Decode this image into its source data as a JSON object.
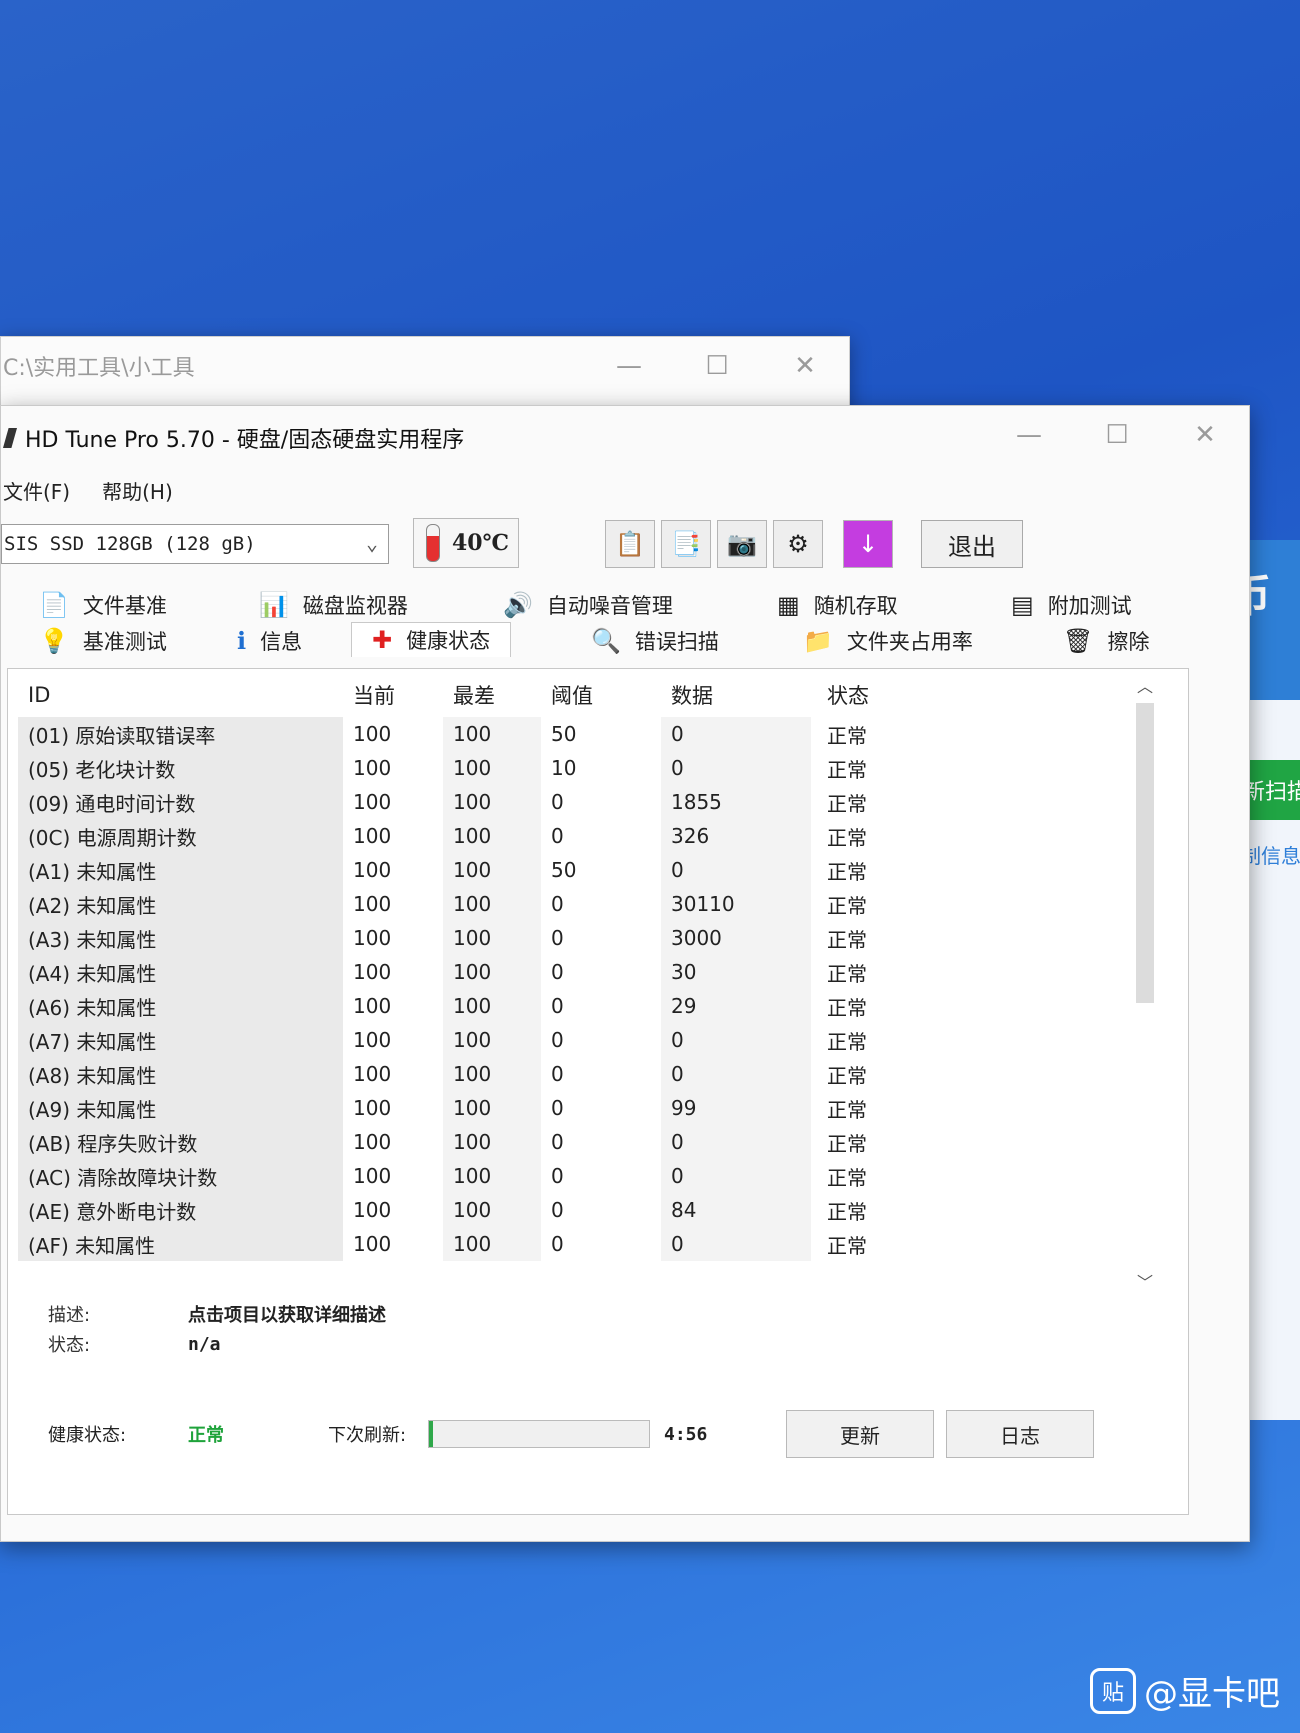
{
  "bg_window": {
    "title": "C:\\实用工具\\小工具",
    "min": "—",
    "max": "☐",
    "close": "✕"
  },
  "right_app": {
    "logo": "币",
    "rescan": "重新扫描",
    "copy": "复制信息"
  },
  "window": {
    "title": "HD Tune Pro 5.70 - 硬盘/固态硬盘实用程序",
    "min": "—",
    "max": "☐",
    "close": "✕"
  },
  "menu": [
    "文件(F)",
    "帮助(H)"
  ],
  "toolbar": {
    "drive": "SIS SSD 128GB (128 gB)",
    "temperature": "40℃",
    "exit": "退出"
  },
  "tabs_top": [
    {
      "label": "文件基准",
      "icon": "📄"
    },
    {
      "label": "磁盘监视器",
      "icon": "📊"
    },
    {
      "label": "自动噪音管理",
      "icon": "🔊"
    },
    {
      "label": "随机存取",
      "icon": "▦"
    },
    {
      "label": "附加测试",
      "icon": "▤"
    }
  ],
  "tabs_bottom": [
    {
      "label": "基准测试",
      "icon": "💡"
    },
    {
      "label": "信息",
      "icon": "ℹ"
    },
    {
      "label": "健康状态",
      "icon": "✚"
    },
    {
      "label": "错误扫描",
      "icon": "🔍"
    },
    {
      "label": "文件夹占用率",
      "icon": "📁"
    },
    {
      "label": "擦除",
      "icon": "🗑"
    }
  ],
  "table": {
    "headers": {
      "id": "ID",
      "current": "当前",
      "worst": "最差",
      "threshold": "阈值",
      "data": "数据",
      "status": "状态"
    },
    "rows": [
      [
        "(01) 原始读取错误率",
        "100",
        "100",
        "50",
        "0",
        "正常"
      ],
      [
        "(05) 老化块计数",
        "100",
        "100",
        "10",
        "0",
        "正常"
      ],
      [
        "(09) 通电时间计数",
        "100",
        "100",
        "0",
        "1855",
        "正常"
      ],
      [
        "(0C) 电源周期计数",
        "100",
        "100",
        "0",
        "326",
        "正常"
      ],
      [
        "(A1) 未知属性",
        "100",
        "100",
        "50",
        "0",
        "正常"
      ],
      [
        "(A2) 未知属性",
        "100",
        "100",
        "0",
        "30110",
        "正常"
      ],
      [
        "(A3) 未知属性",
        "100",
        "100",
        "0",
        "3000",
        "正常"
      ],
      [
        "(A4) 未知属性",
        "100",
        "100",
        "0",
        "30",
        "正常"
      ],
      [
        "(A6) 未知属性",
        "100",
        "100",
        "0",
        "29",
        "正常"
      ],
      [
        "(A7) 未知属性",
        "100",
        "100",
        "0",
        "0",
        "正常"
      ],
      [
        "(A8) 未知属性",
        "100",
        "100",
        "0",
        "0",
        "正常"
      ],
      [
        "(A9) 未知属性",
        "100",
        "100",
        "0",
        "99",
        "正常"
      ],
      [
        "(AB) 程序失败计数",
        "100",
        "100",
        "0",
        "0",
        "正常"
      ],
      [
        "(AC) 清除故障块计数",
        "100",
        "100",
        "0",
        "0",
        "正常"
      ],
      [
        "(AE) 意外断电计数",
        "100",
        "100",
        "0",
        "84",
        "正常"
      ],
      [
        "(AF) 未知属性",
        "100",
        "100",
        "0",
        "0",
        "正常"
      ]
    ]
  },
  "description": {
    "label": "描述:",
    "value": "点击项目以获取详细描述"
  },
  "status_line": {
    "label": "状态:",
    "value": "n/a"
  },
  "health": {
    "label": "健康状态:",
    "value": "正常"
  },
  "refresh": {
    "label": "下次刷新:",
    "time": "4:56",
    "progress": 0.02
  },
  "buttons": {
    "update": "更新",
    "log": "日志"
  },
  "watermark": {
    "badge": "贴",
    "text": "@显卡吧"
  }
}
